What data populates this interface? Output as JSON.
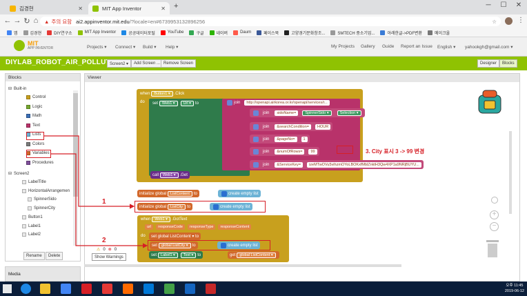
{
  "browser": {
    "tabs": [
      {
        "label": "김경현",
        "active": false
      },
      {
        "label": "MIT App Inventor",
        "active": true
      }
    ],
    "new_tab": "+",
    "window_controls": {
      "minimize": "─",
      "maximize": "☐",
      "close": "✕"
    },
    "nav": {
      "back": "←",
      "forward": "→",
      "reload": "↻",
      "home": "⌂"
    },
    "url": {
      "warning": "주의 요함",
      "host": "ai2.appinventor.mit.edu",
      "path": "/?locale=en#6739953132896256"
    },
    "bookmarks": [
      "앱",
      "김경현",
      "DIY연구소",
      "MIT App Inventor",
      "공공데이터포털",
      "YouTube",
      "구글",
      "네이버",
      "Daum",
      "페이스북",
      "고양경기문화창조...",
      "SMTECH 중소기업...",
      "아래한글->PDF변환",
      "메이크올"
    ]
  },
  "app": {
    "logo": {
      "line1": "MIT",
      "line2": "APP INVENTOR"
    },
    "menus": [
      "Projects ▾",
      "Connect ▾",
      "Build ▾",
      "Help ▾"
    ],
    "right_menus": [
      "My Projects",
      "Gallery",
      "Guide",
      "Report an Issue",
      "English ▾",
      "yahookgh@gmail.com ▾"
    ],
    "project_name": "DIYLAB_ROBOT_AIR_POLLUTION1",
    "screen_select": "Screen2 ▾",
    "add_screen": "Add Screen ...",
    "remove_screen": "Remove Screen",
    "designer": "Designer",
    "blocks": "Blocks"
  },
  "blocks_panel": {
    "title": "Blocks",
    "builtin": "Built-in",
    "builtin_items": [
      {
        "label": "Control",
        "color": "#c8a01e"
      },
      {
        "label": "Logic",
        "color": "#77a830"
      },
      {
        "label": "Math",
        "color": "#3b6fb6"
      },
      {
        "label": "Text",
        "color": "#b8326a"
      },
      {
        "label": "Lists",
        "color": "#6cb3d6"
      },
      {
        "label": "Colors",
        "color": "#7b7b7b"
      },
      {
        "label": "Variables",
        "color": "#d2682b"
      },
      {
        "label": "Procedures",
        "color": "#7f4f9a"
      }
    ],
    "screen": "Screen2",
    "components": [
      "LabelTitle",
      "HorizontalArrangemen",
      "SpinnerSido",
      "SpinnerCity",
      "Button1",
      "Label1",
      "Label2"
    ],
    "rename": "Rename",
    "delete": "Delete"
  },
  "media_panel": {
    "title": "Media"
  },
  "viewer": {
    "title": "Viewer",
    "event1": {
      "when": "when",
      "component": "Button1 ▾",
      "event": ".Click",
      "do": "do"
    },
    "set_web": {
      "set": "set",
      "component": "Web1 ▾",
      "prop": "Url ▾",
      "to": "to",
      "join": "join"
    },
    "join_strings": [
      "http://openapi.airkorea.or.kr/openapi/services/r...",
      "sidoName=",
      "&searchCondition=",
      "&pageNo=",
      "&numOfRows=",
      "&ServiceKey="
    ],
    "join_values": [
      "SpinnerSido ▾",
      "Selection ▾",
      "HOUR",
      "1",
      "99",
      "izeMTwOVu5vihzmOYoLBOKxfMblZnktH3Qw4XP1a9NRjBUYU..."
    ],
    "join_label": "join",
    "call_get": {
      "call": "call",
      "component": "Web1 ▾",
      "method": ".Get"
    },
    "init1": {
      "label": "initialize global",
      "name": "ListContent",
      "to": "to",
      "value": "create empty list"
    },
    "init2": {
      "label": "initialize global",
      "name": "ListCity",
      "to": "to",
      "value": "create empty list"
    },
    "event2": {
      "when": "when",
      "component": "Web1 ▾",
      "event": ".GotText",
      "params": [
        "url",
        "responseCode",
        "responseType",
        "responseContent"
      ],
      "do": "do"
    },
    "set_content": "set global ListContent ▾ to",
    "set_city": {
      "set": "set",
      "name": "global ListCity ▾",
      "to": "to",
      "value": "create empty list"
    },
    "set_label": {
      "set": "set",
      "component": "Label1 ▾",
      "prop": "Text ▾",
      "to": "to",
      "get": "get",
      "name": "global ListContent ▾"
    },
    "warnings": {
      "count_warn": "0",
      "count_err": "0",
      "button": "Show Warnings"
    },
    "annotations": {
      "step1": "1",
      "step2": "2",
      "note": "3. City 표시 3 -> 99 변경"
    }
  },
  "taskbar": {
    "time": "오후 11:45",
    "date": "2019-06-12"
  }
}
